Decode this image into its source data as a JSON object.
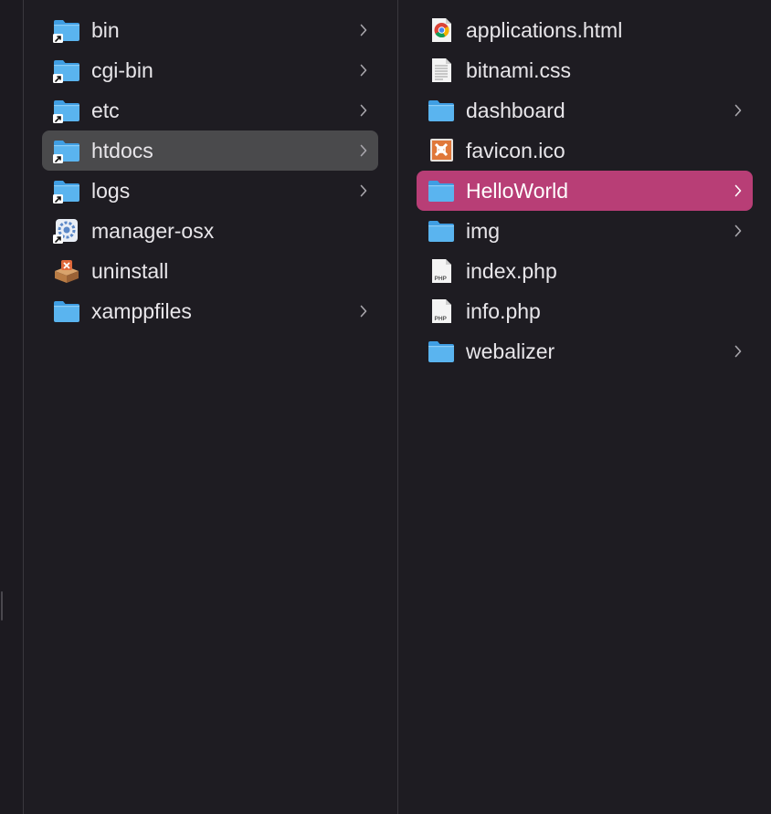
{
  "columns": [
    {
      "items": [
        {
          "label": "bin",
          "icon": "folder-alias-icon",
          "chevron": true
        },
        {
          "label": "cgi-bin",
          "icon": "folder-alias-icon",
          "chevron": true
        },
        {
          "label": "etc",
          "icon": "folder-alias-icon",
          "chevron": true
        },
        {
          "label": "htdocs",
          "icon": "folder-alias-icon",
          "chevron": true,
          "selected": "inactive"
        },
        {
          "label": "logs",
          "icon": "folder-alias-icon",
          "chevron": true
        },
        {
          "label": "manager-osx",
          "icon": "app-alias-icon",
          "chevron": false
        },
        {
          "label": "uninstall",
          "icon": "uninstaller-app-icon",
          "chevron": false
        },
        {
          "label": "xamppfiles",
          "icon": "folder-icon",
          "chevron": true
        }
      ]
    },
    {
      "items": [
        {
          "label": "applications.html",
          "icon": "chrome-html-file-icon",
          "chevron": false
        },
        {
          "label": "bitnami.css",
          "icon": "text-document-icon",
          "chevron": false
        },
        {
          "label": "dashboard",
          "icon": "folder-icon",
          "chevron": true
        },
        {
          "label": "favicon.ico",
          "icon": "xampp-ico-file-icon",
          "chevron": false
        },
        {
          "label": "HelloWorld",
          "icon": "folder-icon",
          "chevron": true,
          "selected": "active"
        },
        {
          "label": "img",
          "icon": "folder-icon",
          "chevron": true
        },
        {
          "label": "index.php",
          "icon": "php-file-icon",
          "chevron": false
        },
        {
          "label": "info.php",
          "icon": "php-file-icon",
          "chevron": false
        },
        {
          "label": "webalizer",
          "icon": "folder-icon",
          "chevron": true
        }
      ]
    }
  ],
  "file_icon_badge": "PHP",
  "colors": {
    "background": "#1e1c22",
    "selection_active": "#b83e76",
    "selection_inactive": "#4a4a4c",
    "folder": "#5ab4ef",
    "text": "#e8e6ea"
  }
}
